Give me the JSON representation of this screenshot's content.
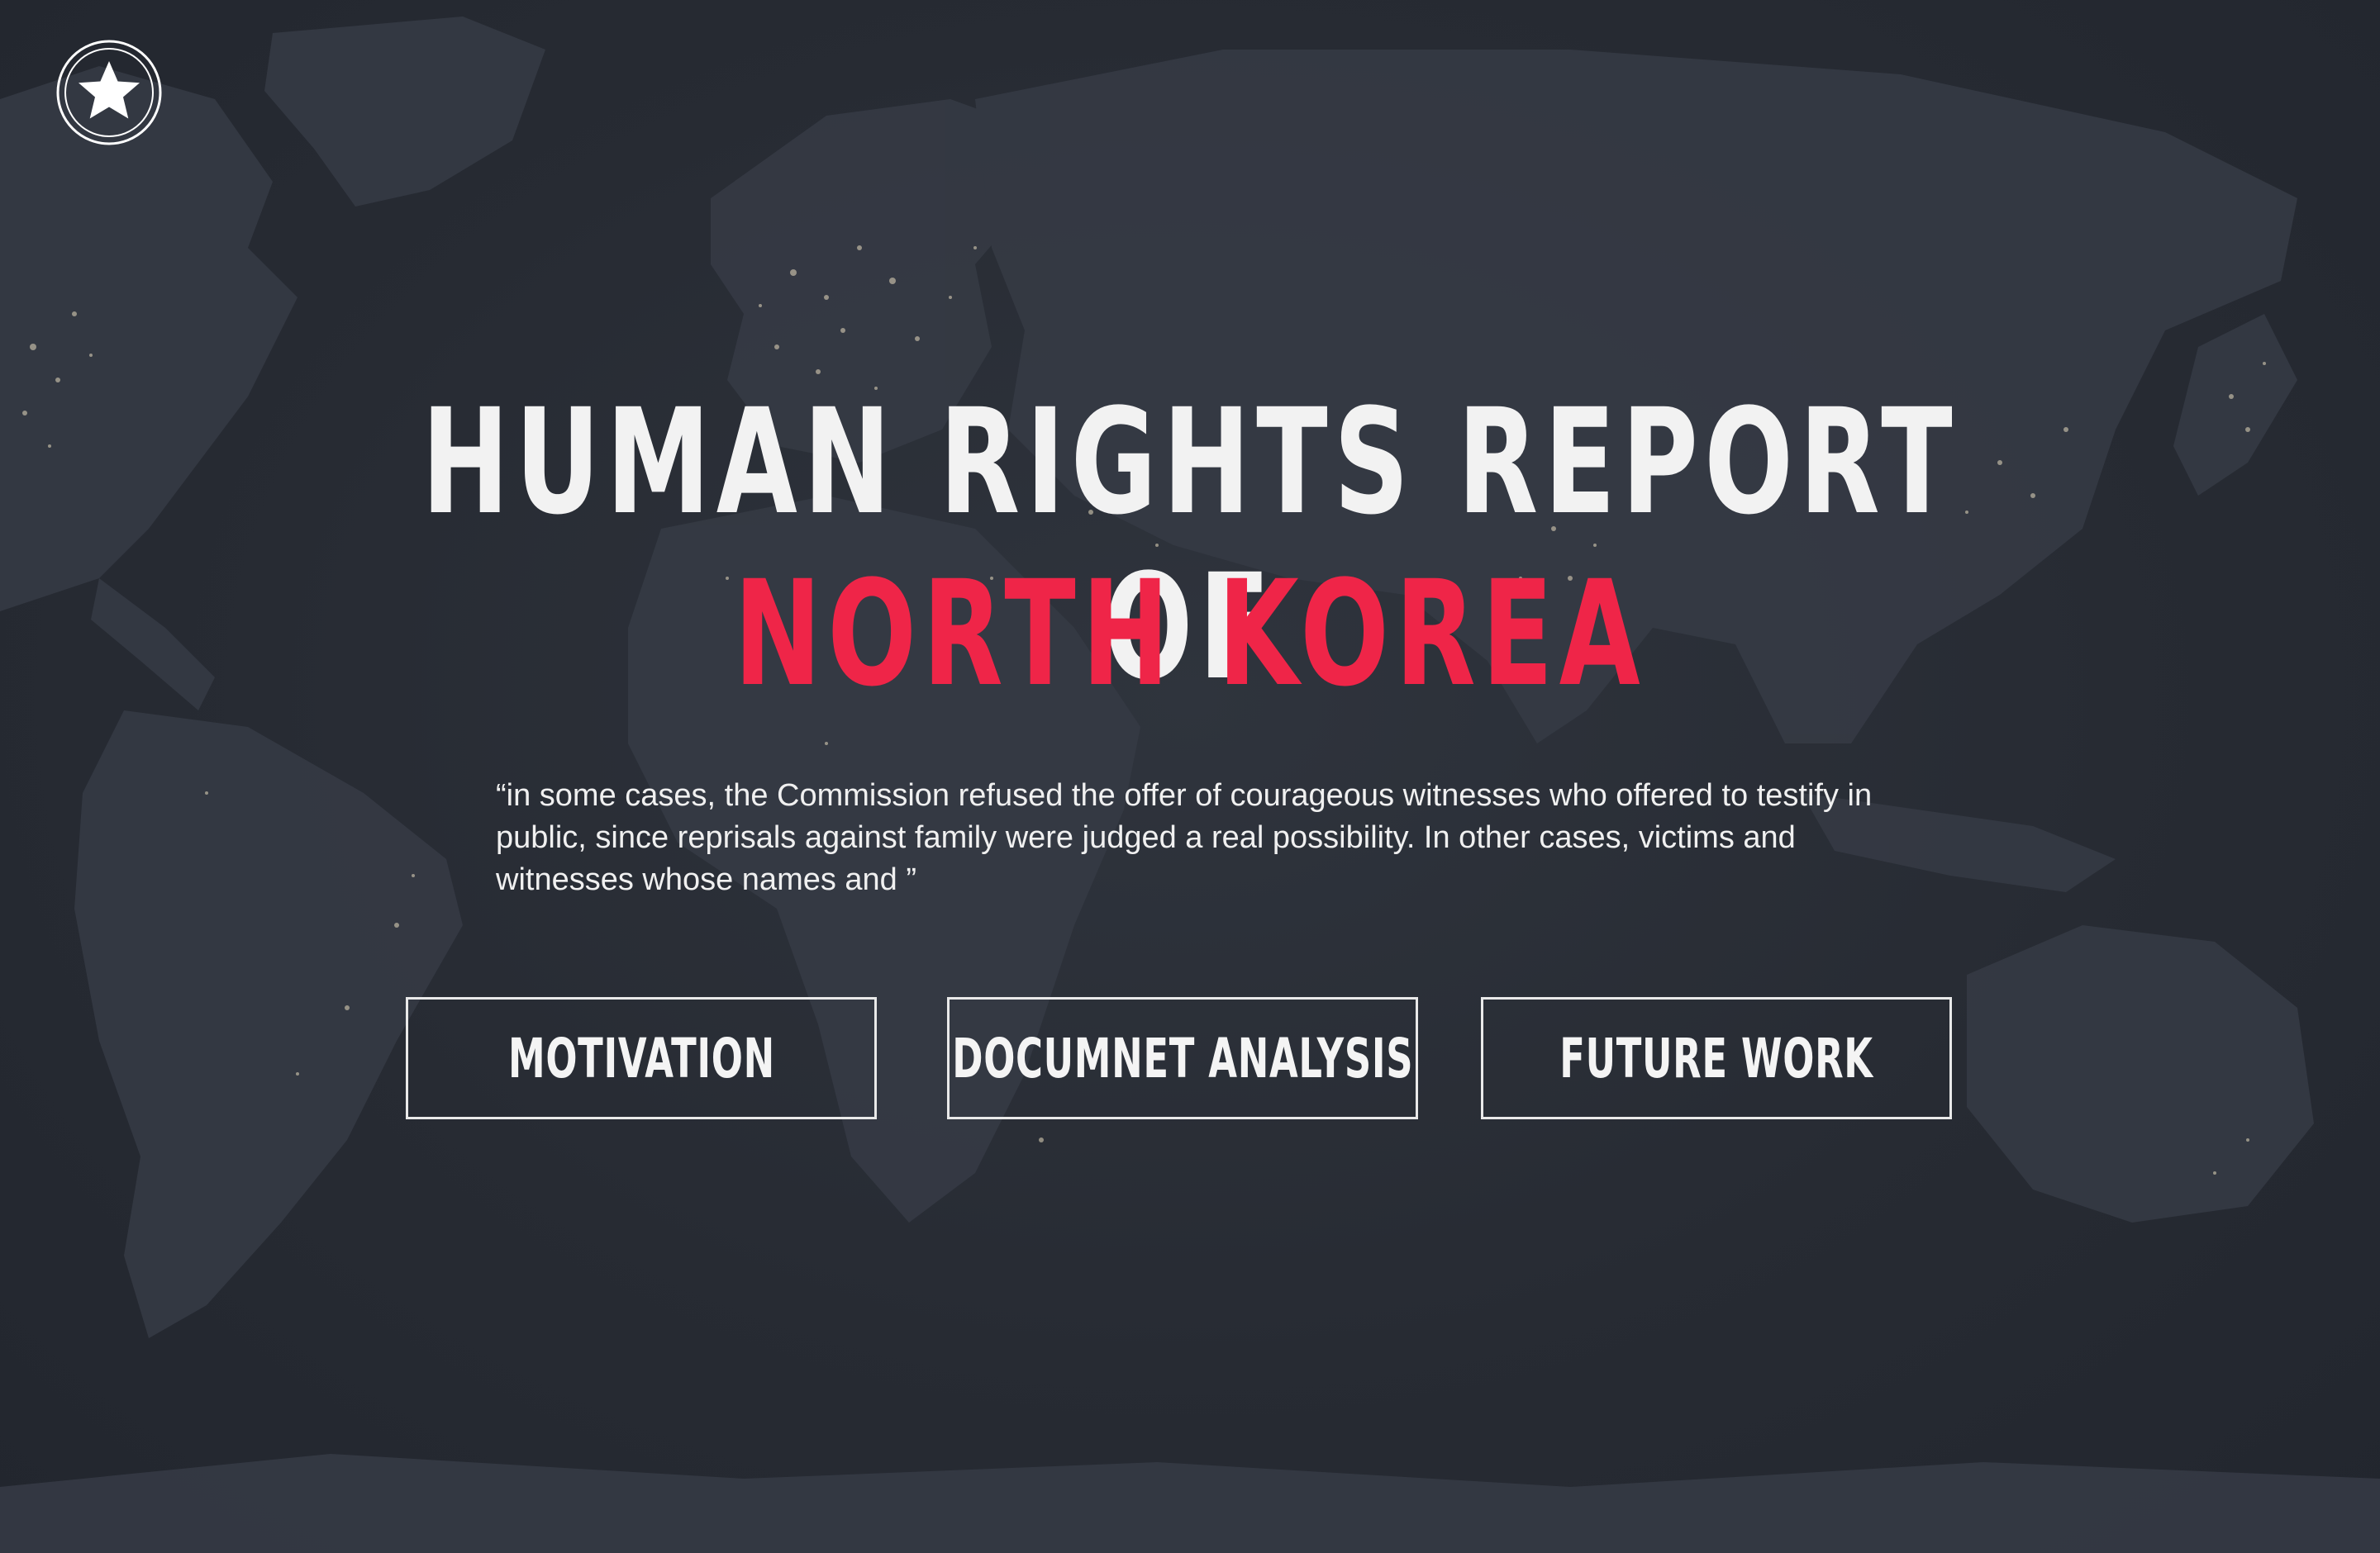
{
  "page": {
    "title_line_1": "HUMAN RIGHTS REPORT OF",
    "title_line_2": "NORTH KOREA",
    "quote": "“in some cases, the Commission refused the offer of courageous witnesses who offered to testify in public, since reprisals against family were judged a real possibility. In other cases, victims and witnesses whose names and ”"
  },
  "logo": {
    "icon": "star-icon"
  },
  "background": {
    "image": "world-map-night-lights"
  },
  "nav_buttons": [
    {
      "label": "MOTIVATION"
    },
    {
      "label": "DOCUMNET ANALYSIS"
    },
    {
      "label": "FUTURE WORK"
    }
  ],
  "colors": {
    "background": "#252a33",
    "title": "#f2f2f2",
    "accent": "#ef2548",
    "button_border": "#e9e9e9"
  }
}
